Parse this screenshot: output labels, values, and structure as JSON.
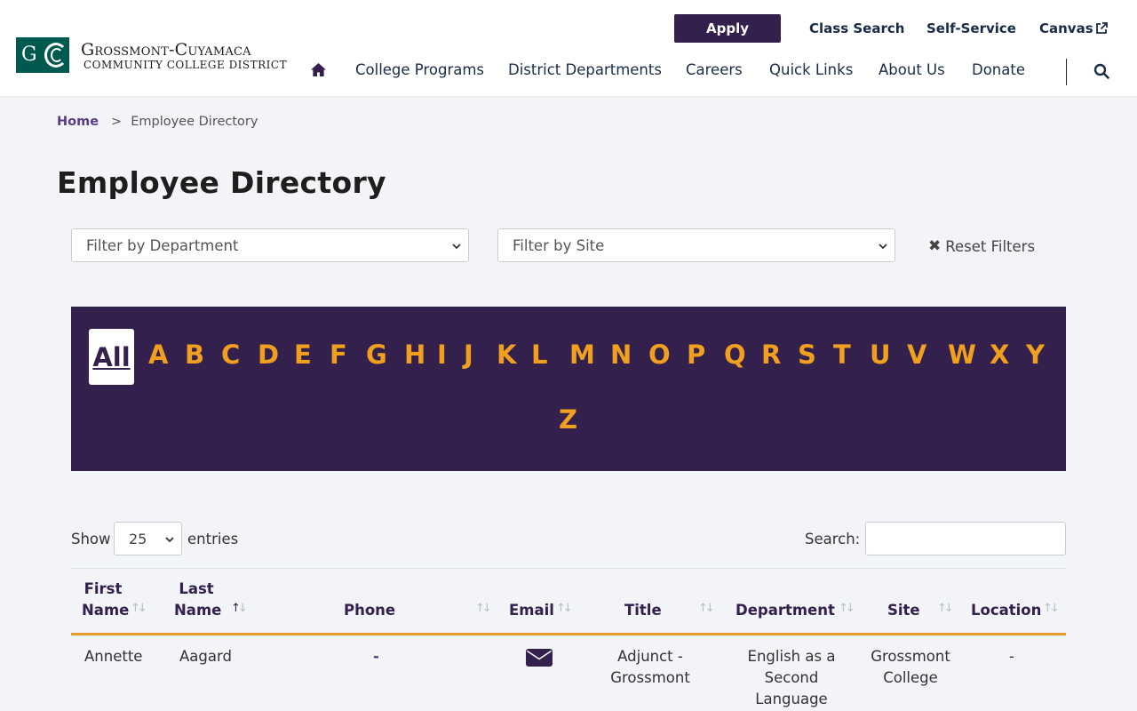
{
  "header": {
    "logo": {
      "line1": "Grossmont-Cuyamaca",
      "line2": "Community College District",
      "mark_letter": "G"
    },
    "utility_links": {
      "apply": "Apply",
      "class_search": "Class Search",
      "self_service": "Self-Service",
      "canvas": "Canvas"
    },
    "nav": {
      "college_programs": "College Programs",
      "district_departments": "District Departments",
      "careers": "Careers",
      "quick_links": "Quick Links",
      "about_us": "About Us",
      "donate": "Donate"
    },
    "icons": {
      "home": "home-icon",
      "search": "search-icon",
      "external": "external-link-icon"
    }
  },
  "breadcrumb": {
    "home": "Home",
    "separator": ">",
    "current": "Employee Directory"
  },
  "page_title": "Employee Directory",
  "filters": {
    "department": "Filter by Department",
    "site": "Filter by Site",
    "reset_icon": "✖",
    "reset": "Reset Filters"
  },
  "alphabet": {
    "all": "All",
    "letters": [
      "A",
      "B",
      "C",
      "D",
      "E",
      "F",
      "G",
      "H",
      "I",
      "J",
      "K",
      "L",
      "M",
      "N",
      "O",
      "P",
      "Q",
      "R",
      "S",
      "T",
      "U",
      "V",
      "W",
      "X",
      "Y",
      "Z"
    ]
  },
  "table_controls": {
    "show": "Show",
    "entries_value": "25",
    "entries": "entries",
    "search_label": "Search:",
    "search_value": ""
  },
  "table": {
    "headers": {
      "first_name_1": "First",
      "first_name_2": "Name",
      "last_name_1": "Last",
      "last_name_2": "Name",
      "phone": "Phone",
      "email": "Email",
      "title": "Title",
      "department": "Department",
      "site": "Site",
      "location": "Location"
    },
    "sort_glyph": "↑↓",
    "rows": [
      {
        "first_name": "Annette",
        "last_name": "Aagard",
        "phone": "-",
        "email_icon": "envelope-icon",
        "title_1": "Adjunct -",
        "title_2": "Grossmont",
        "department_1": "English as a",
        "department_2": "Second",
        "department_3": "Language",
        "site_1": "Grossmont",
        "site_2": "College",
        "location": "-"
      }
    ]
  },
  "colors": {
    "brand_purple": "#33204c",
    "accent_orange": "#f0a01e",
    "logo_green": "#00594f",
    "link_purple": "#5a3a8a",
    "page_bg": "#f2f4f7"
  }
}
